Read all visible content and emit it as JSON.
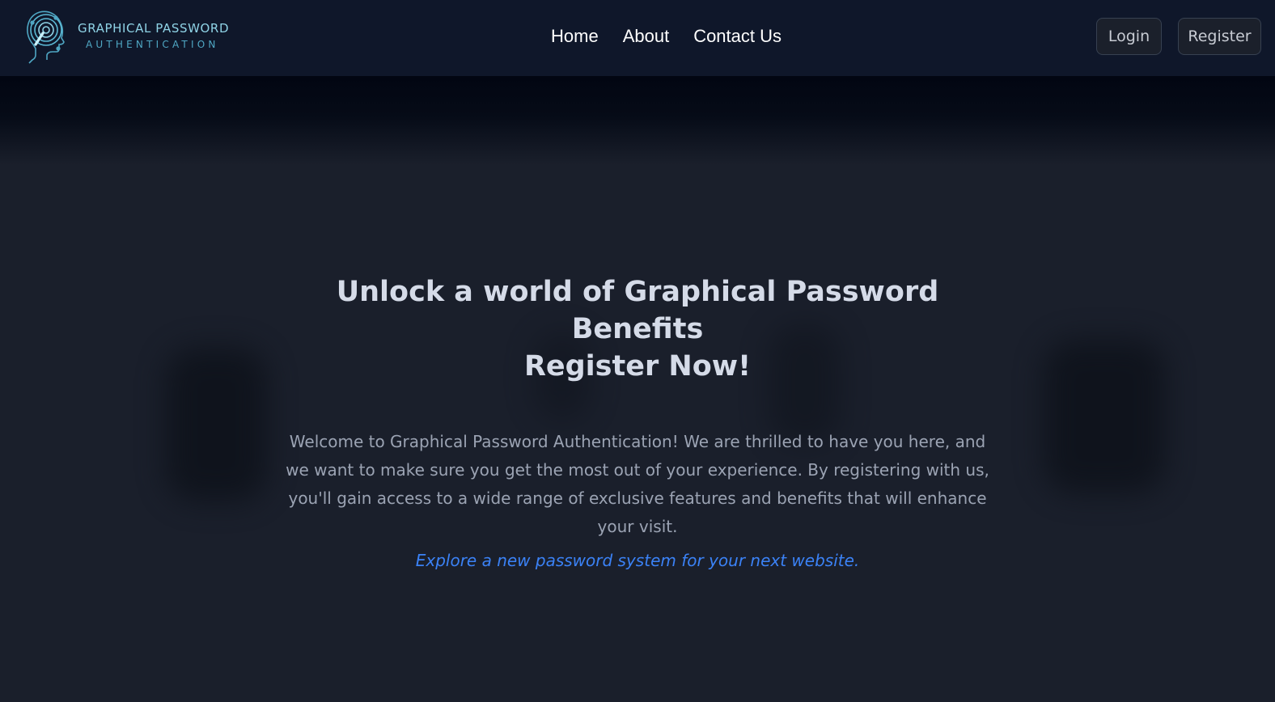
{
  "brand": {
    "line1": "GRAPHICAL PASSWORD",
    "line2": "AUTHENTICATION",
    "logo_icon": "head-fingerprint-icon",
    "colors": {
      "primary": "#8fd3e6",
      "secondary": "#4fa7c4"
    }
  },
  "nav": {
    "links": [
      "Home",
      "About",
      "Contact Us"
    ]
  },
  "auth": {
    "login_label": "Login",
    "register_label": "Register"
  },
  "hero": {
    "title_line1": "Unlock a world of Graphical Password Benefits",
    "title_line2": "Register Now!",
    "description": "Welcome to Graphical Password Authentication! We are thrilled to have you here, and we want to make sure you get the most out of your experience. By registering with us, you'll gain access to a wide range of exclusive features and benefits that will enhance your visit.",
    "tagline": "Explore a new password system for your next website."
  },
  "colors": {
    "navbar_bg": "#0f172a",
    "page_bg": "#1a1f2b",
    "accent": "#3b82f6"
  }
}
